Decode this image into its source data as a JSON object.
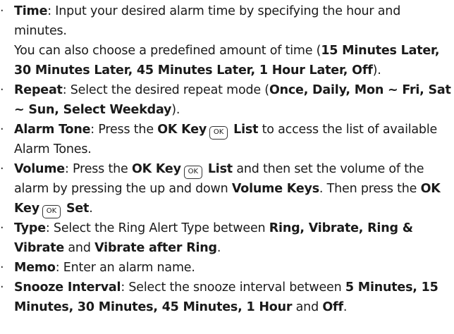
{
  "items": [
    {
      "term": "Time",
      "desc": ": Input your desired alarm time by specifying the hour and minutes.",
      "note_pre": "You can also choose a predefined amount of time (",
      "note_options": "15 Minutes Later, 30 Minutes Later, 45 Minutes Later, 1 Hour Later, Off",
      "note_post": ")."
    },
    {
      "term": "Repeat",
      "desc_pre": ": Select the desired repeat mode (",
      "options": "Once, Daily, Mon ~ Fri, Sat ~ Sun, Select Weekday",
      "desc_post": ")."
    },
    {
      "term": "Alarm Tone",
      "desc_pre": ": Press the ",
      "ok_key": "OK Key",
      "key_icon": "OK",
      "list": "List",
      "desc_post": " to access the list of available Alarm Tones."
    },
    {
      "term": "Volume",
      "desc_pre": ": Press the ",
      "ok_key": "OK Key",
      "key_icon": "OK",
      "list": "List",
      "desc_mid": " and then set the volume of the alarm by pressing the up and down ",
      "volume_keys": "Volume Keys",
      "desc_mid2": ". Then press the ",
      "ok_key2": "OK Key",
      "key_icon2": "OK",
      "set": "Set",
      "desc_post": "."
    },
    {
      "term": "Type",
      "desc_pre": ": Select the Ring Alert Type between ",
      "options": "Ring, Vibrate, Ring & Vibrate",
      "and": " and ",
      "option_last": "Vibrate after Ring",
      "desc_post": "."
    },
    {
      "term": "Memo",
      "desc": ": Enter an alarm name."
    },
    {
      "term": "Snooze Interval",
      "desc_pre": ": Select the snooze interval between ",
      "options": "5 Minutes, 15 Minutes, 30 Minutes, 45 Minutes, 1 Hour",
      "and": " and ",
      "option_last": "Off",
      "desc_post": "."
    }
  ],
  "bullet_char": "·"
}
